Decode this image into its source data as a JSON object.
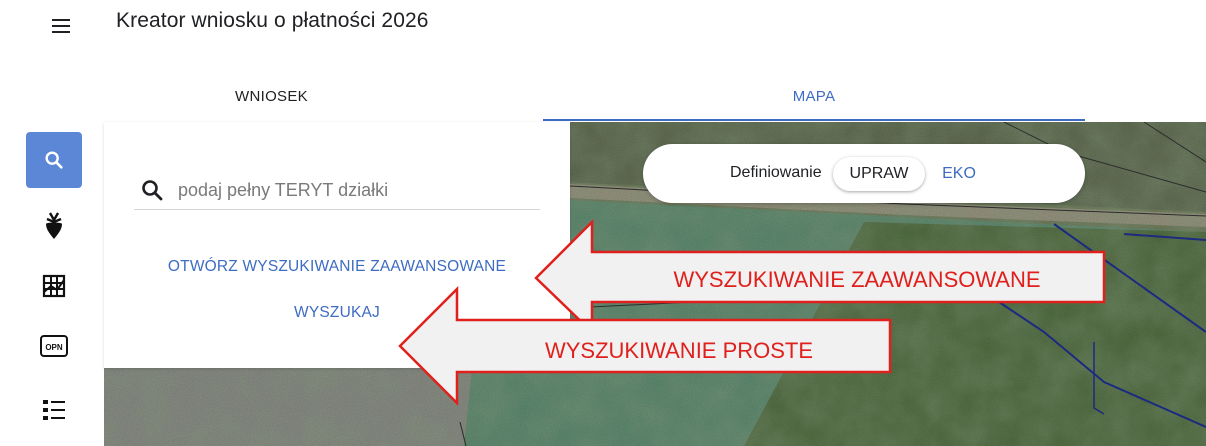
{
  "app": {
    "title": "Kreator wniosku o płatności 2026"
  },
  "tabs": [
    {
      "label": "WNIOSEK",
      "active": false
    },
    {
      "label": "MAPA",
      "active": true
    }
  ],
  "rail": {
    "items": [
      {
        "icon": "search-icon",
        "active": true
      },
      {
        "icon": "beet-icon",
        "active": false
      },
      {
        "icon": "grid-map-icon",
        "active": false
      },
      {
        "icon": "opn-icon",
        "badge": "OPN",
        "active": false
      },
      {
        "icon": "list-icon",
        "active": false
      }
    ]
  },
  "search": {
    "placeholder": "podaj pełny TERYT działki",
    "value": "",
    "advanced_link": "OTWÓRZ WYSZUKIWANIE ZAAWANSOWANE",
    "search_button": "WYSZUKAJ"
  },
  "mode": {
    "label": "Definiowanie",
    "options": [
      {
        "label": "UPRAW",
        "selected": true
      },
      {
        "label": "EKO",
        "selected": false
      }
    ]
  },
  "annotations": {
    "advanced": "WYSZUKIWANIE ZAAWANSOWANE",
    "simple": "WYSZUKIWANIE PROSTE"
  },
  "colors": {
    "accent": "#3d6cc1",
    "rail_active": "#5b87d6",
    "callout_red": "#e0201c",
    "callout_fill": "#f1f1f1"
  }
}
